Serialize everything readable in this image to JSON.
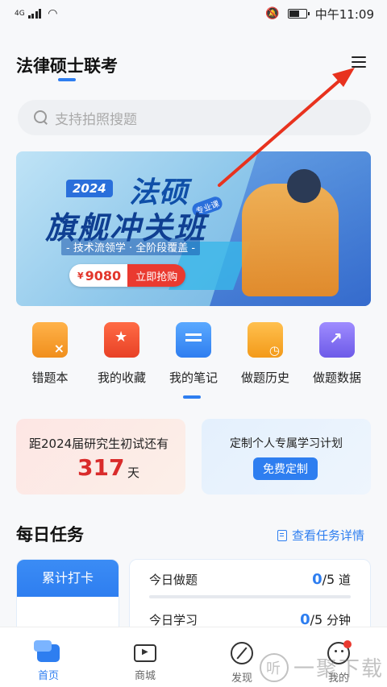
{
  "status_bar": {
    "network": "4G",
    "time": "中午11:09"
  },
  "header": {
    "title": "法律硕士联考"
  },
  "search": {
    "placeholder": "支持拍照搜题"
  },
  "banner": {
    "year": "2024",
    "title_line1": "法硕",
    "title_line2": "旗舰冲关班",
    "subtitle": "- 技术流领学 · 全阶段覆盖 -",
    "tag": "专业课",
    "price_symbol": "¥",
    "price": "9080",
    "cta": "立即抢购"
  },
  "shortcuts": [
    {
      "label": "错题本",
      "icon": "error-book-icon"
    },
    {
      "label": "我的收藏",
      "icon": "favorites-icon"
    },
    {
      "label": "我的笔记",
      "icon": "notes-icon"
    },
    {
      "label": "做题历史",
      "icon": "history-icon"
    },
    {
      "label": "做题数据",
      "icon": "data-icon"
    }
  ],
  "exam_card": {
    "text": "距2024届研究生初试还有",
    "days": "317",
    "unit": "天"
  },
  "plan_card": {
    "text": "定制个人专属学习计划",
    "button": "免费定制"
  },
  "daily_task": {
    "title": "每日任务",
    "link": "查看任务详情",
    "checkin": "累计打卡",
    "tasks": [
      {
        "label": "今日做题",
        "done": "0",
        "total": "/5",
        "unit": "道"
      },
      {
        "label": "今日学习",
        "done": "0",
        "total": "/5",
        "unit": "分钟"
      }
    ]
  },
  "bottom_nav": [
    {
      "label": "首页",
      "icon": "home-icon"
    },
    {
      "label": "商城",
      "icon": "store-icon"
    },
    {
      "label": "发现",
      "icon": "discover-icon"
    },
    {
      "label": "我的",
      "icon": "profile-icon"
    }
  ],
  "watermark": "一聚下载",
  "colors": {
    "accent": "#2e7ef0",
    "danger": "#ea3a30",
    "annotation_arrow": "#e8321e"
  }
}
